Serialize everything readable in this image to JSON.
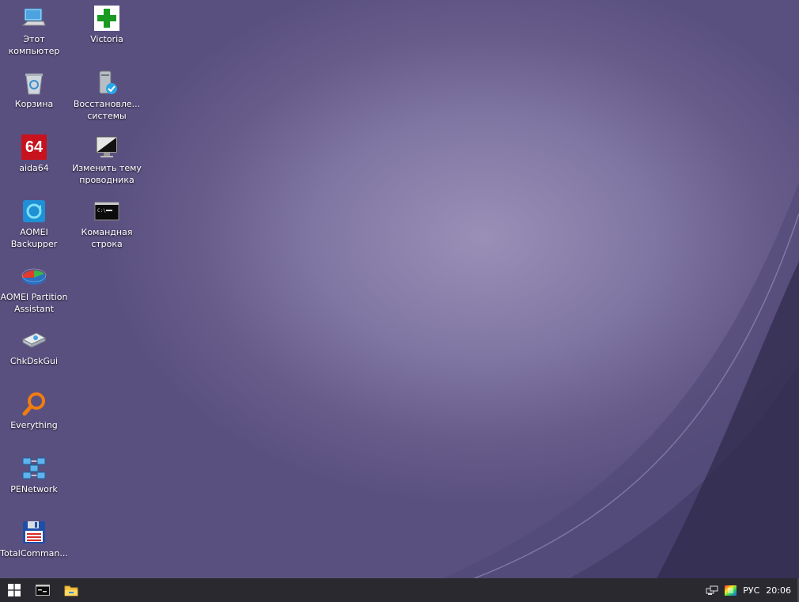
{
  "desktop": {
    "icons": [
      {
        "name": "this-pc",
        "label_line1": "Этот",
        "label_line2": "компьютер"
      },
      {
        "name": "victoria",
        "label_line1": "Victoria",
        "label_line2": ""
      },
      {
        "name": "recycle-bin",
        "label_line1": "Корзина",
        "label_line2": ""
      },
      {
        "name": "system-restore",
        "label_line1": "Восстановле...",
        "label_line2": "системы"
      },
      {
        "name": "aida64",
        "label_line1": "aida64",
        "label_line2": "",
        "glyph_text": "64"
      },
      {
        "name": "change-explorer-theme",
        "label_line1": "Изменить тему",
        "label_line2": "проводника"
      },
      {
        "name": "aomei-backupper",
        "label_line1": "AOMEI",
        "label_line2": "Backupper"
      },
      {
        "name": "command-prompt",
        "label_line1": "Командная",
        "label_line2": "строка"
      },
      {
        "name": "aomei-partition-assistant",
        "label_line1": "AOMEI Partition",
        "label_line2": "Assistant"
      },
      {
        "name": "chkdskgui",
        "label_line1": "ChkDskGui",
        "label_line2": ""
      },
      {
        "name": "everything",
        "label_line1": "Everything",
        "label_line2": ""
      },
      {
        "name": "penetwork",
        "label_line1": "PENetwork",
        "label_line2": ""
      },
      {
        "name": "totalcommander",
        "label_line1": "TotalComman...",
        "label_line2": ""
      }
    ]
  },
  "taskbar": {
    "start_icon": "windows-logo-icon",
    "pinned": [
      "command-prompt-icon",
      "file-explorer-icon"
    ],
    "tray": {
      "network_icon": "network-icon",
      "color_icon": "display-color-icon",
      "language": "РУС",
      "time": "20:06"
    }
  },
  "colors": {
    "taskbar_bg": "#2b2930",
    "wallpaper_center": "#9a8fb7",
    "wallpaper_edge": "#5a5080"
  }
}
